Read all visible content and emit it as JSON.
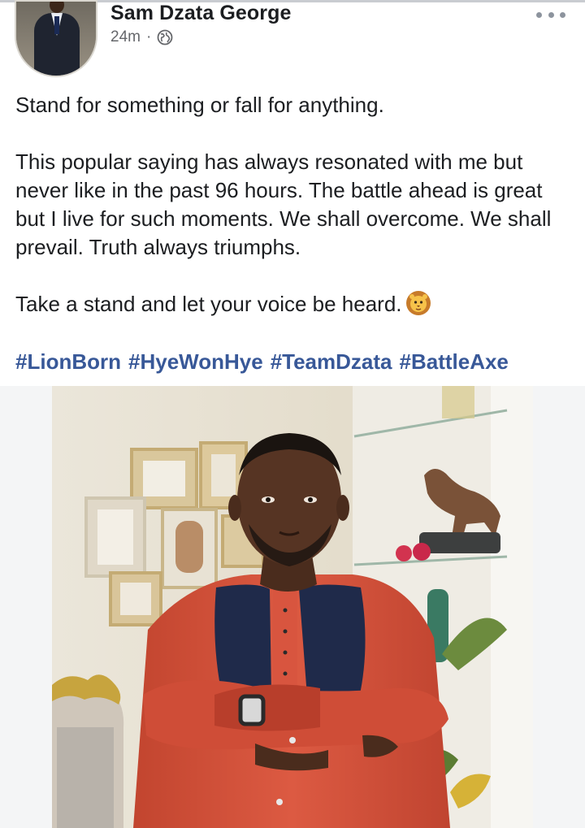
{
  "post": {
    "author_name": "Sam Dzata George",
    "timestamp": "24m",
    "separator": "·",
    "privacy_icon": "globe-icon",
    "menu_icon": "more-options-icon",
    "paragraphs": [
      "Stand for something or fall for anything.",
      "This popular saying has always resonated with me but never like in the past 96 hours. The battle ahead is great but I live for such moments. We shall overcome. We shall prevail. Truth always triumphs.",
      "Take a stand and let your voice be heard."
    ],
    "emoji_icon": "lion-face-icon",
    "hashtags": [
      "#LionBorn",
      "#HyeWonHye",
      "#TeamDzata",
      "#BattleAxe"
    ]
  },
  "colors": {
    "text": "#1c1e21",
    "secondary_text": "#65676b",
    "hashtag": "#385898",
    "shirt": "#d9543f",
    "panel": "#1e2a4a"
  }
}
